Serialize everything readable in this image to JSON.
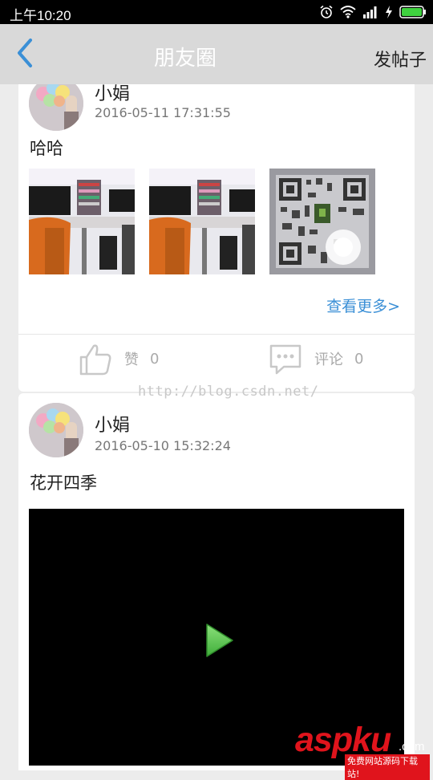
{
  "status_bar": {
    "time": "上午10:20"
  },
  "header": {
    "title": "朋友圈",
    "post_button": "发帖子"
  },
  "posts": [
    {
      "user": "小娟",
      "time": "2016-05-11 17:31:55",
      "text": "哈哈",
      "more_label": "查看更多>",
      "like_label": "赞",
      "like_count": "0",
      "comment_label": "评论",
      "comment_count": "0"
    },
    {
      "user": "小娟",
      "time": "2016-05-10 15:32:24",
      "text": "花开四季"
    }
  ],
  "watermark": {
    "url": "http://blog.csdn.net/",
    "brand_a": "asp",
    "brand_b": "ku",
    "brand_com": ".com",
    "brand_sub": "免费网站源码下载站!"
  },
  "colors": {
    "accent": "#3a8fd6",
    "header_bg": "#d9d9d9",
    "brand_red": "#e0141c"
  }
}
